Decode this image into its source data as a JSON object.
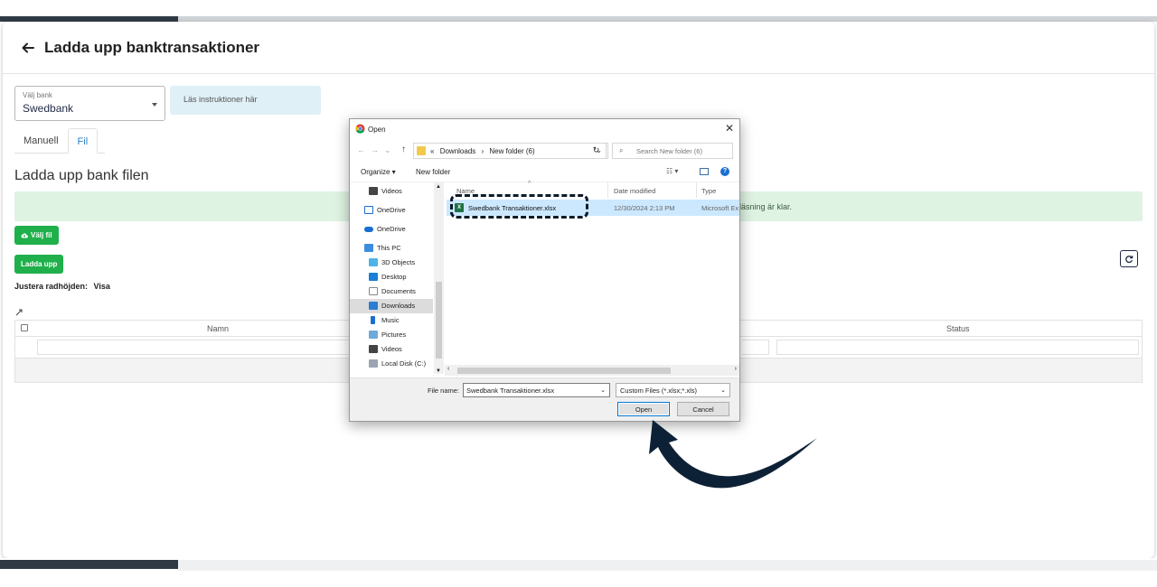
{
  "app": {
    "page_title": "Ladda upp banktransaktioner",
    "bank_select": {
      "label": "Välj bank",
      "value": "Swedbank"
    },
    "instructions": "Läs instruktioner här",
    "tabs": [
      {
        "label": "Manuell"
      },
      {
        "label": "Fil",
        "active": true
      }
    ],
    "section_title": "Ladda upp bank filen",
    "success_message": "läsning är klar.",
    "choose_file_button": "Välj fil",
    "upload_button": "Ladda upp",
    "row_height": {
      "label": "Justera radhöjden:",
      "value": "Visa"
    },
    "grid": {
      "columns": [
        "Namn",
        "Status"
      ]
    },
    "accent_green": "#20b04b",
    "success_bg": "#dff3e3"
  },
  "dialog": {
    "title": "Open",
    "breadcrumb": [
      "«",
      "Downloads",
      "›",
      "New folder (6)"
    ],
    "search_placeholder": "Search New folder (6)",
    "organize": "Organize ▾",
    "new_folder": "New folder",
    "nav_items": [
      {
        "label": "Videos",
        "icon": "video-icon"
      },
      {
        "label": "OneDrive",
        "icon": "onedrive-icon"
      },
      {
        "label": "OneDrive",
        "icon": "cloud-icon"
      },
      {
        "label": "This PC",
        "icon": "computer-icon"
      },
      {
        "label": "3D Objects",
        "icon": "cube-icon"
      },
      {
        "label": "Desktop",
        "icon": "desktop-icon"
      },
      {
        "label": "Documents",
        "icon": "document-icon"
      },
      {
        "label": "Downloads",
        "icon": "download-icon",
        "selected": true
      },
      {
        "label": "Music",
        "icon": "music-icon"
      },
      {
        "label": "Pictures",
        "icon": "picture-icon"
      },
      {
        "label": "Videos",
        "icon": "video-icon"
      },
      {
        "label": "Local Disk (C:)",
        "icon": "disk-icon"
      }
    ],
    "columns": {
      "name": "Name",
      "date": "Date modified",
      "type": "Type"
    },
    "file": {
      "name": "Swedbank Transaktioner.xlsx",
      "date": "12/30/2024 2:13 PM",
      "type": "Microsoft Ex",
      "icon_letter": "X"
    },
    "file_name_label": "File name:",
    "file_name_value": "Swedbank Transaktioner.xlsx",
    "filter": "Custom Files (*.xlsx;*.xls)",
    "open_button": "Open",
    "cancel_button": "Cancel",
    "close_glyph": "✕"
  },
  "annotation": {
    "arrow_color": "#0d2136"
  }
}
